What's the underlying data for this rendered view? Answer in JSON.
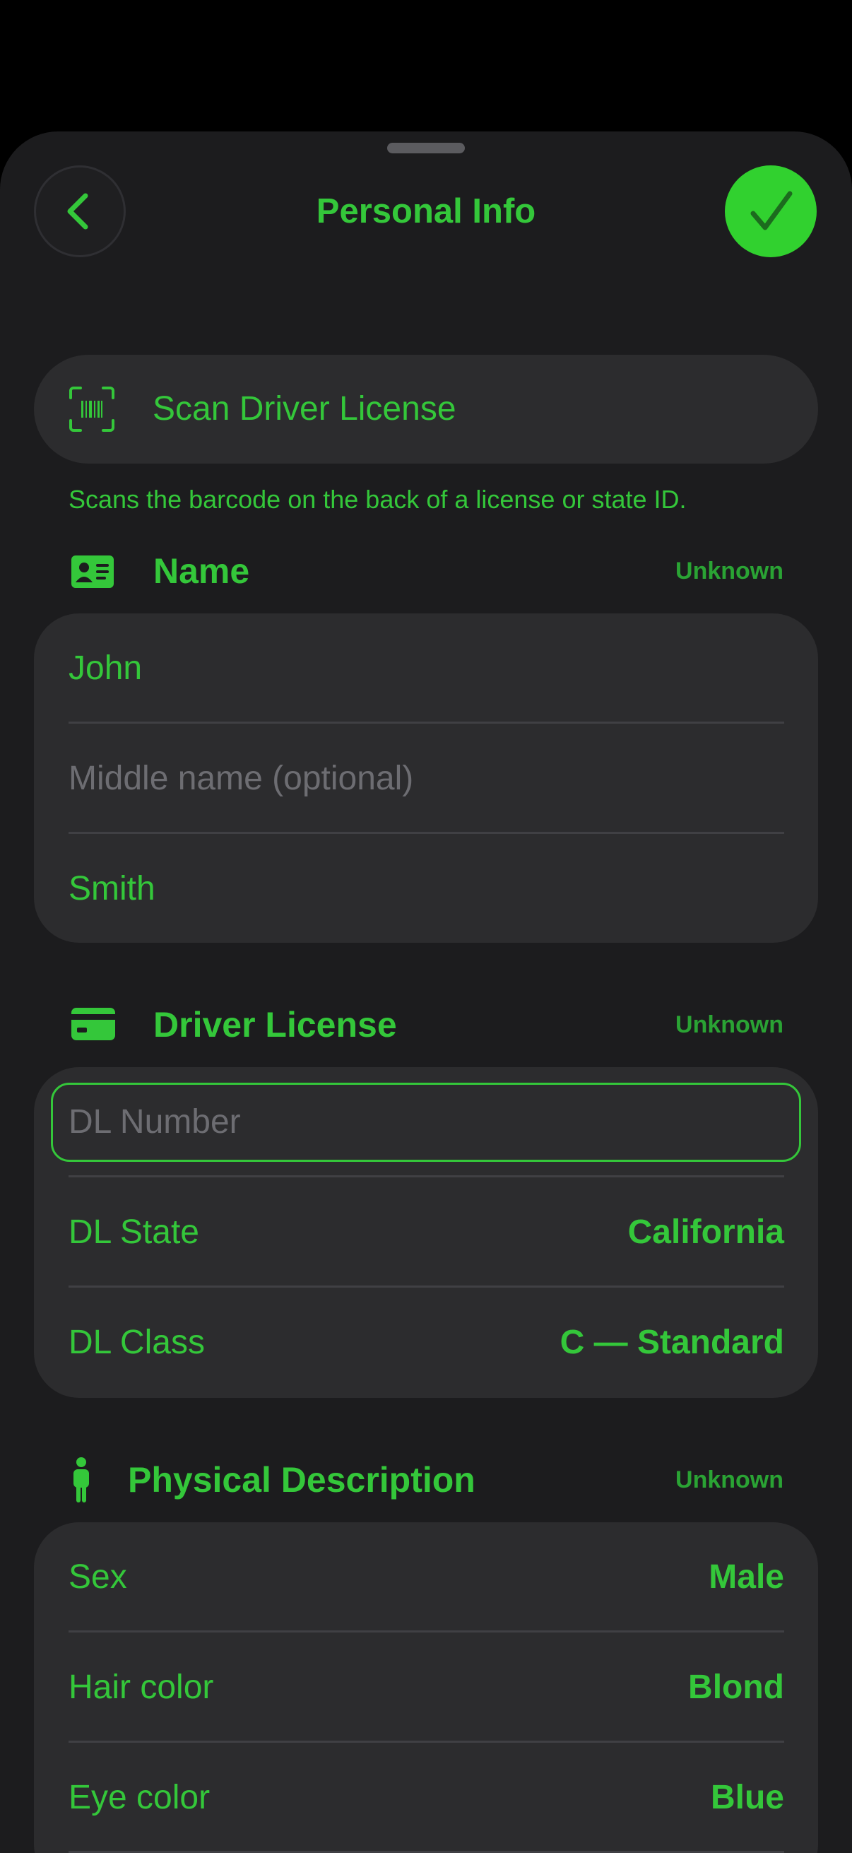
{
  "header": {
    "title": "Personal Info",
    "back_icon": "chevron-left-icon",
    "done_icon": "checkmark-icon"
  },
  "scan": {
    "label": "Scan Driver License",
    "caption": "Scans the barcode on the back of a license or state ID.",
    "icon": "barcode-scan-icon"
  },
  "sections": {
    "name": {
      "title": "Name",
      "status": "Unknown",
      "icon": "id-card-icon",
      "first": "John",
      "middle_placeholder": "Middle name (optional)",
      "last": "Smith"
    },
    "license": {
      "title": "Driver License",
      "status": "Unknown",
      "icon": "credit-card-icon",
      "number_placeholder": "DL Number",
      "state_label": "DL State",
      "state_value": "California",
      "class_label": "DL Class",
      "class_value": "C — Standard"
    },
    "physical": {
      "title": "Physical Description",
      "status": "Unknown",
      "icon": "person-icon",
      "rows": [
        {
          "label": "Sex",
          "value": "Male"
        },
        {
          "label": "Hair color",
          "value": "Blond"
        },
        {
          "label": "Eye color",
          "value": "Blue"
        }
      ]
    }
  },
  "colors": {
    "accent": "#34c73a",
    "confirm": "#31d12f",
    "background": "#1c1c1e",
    "card": "#2c2c2e",
    "placeholder": "#6d6d72"
  }
}
